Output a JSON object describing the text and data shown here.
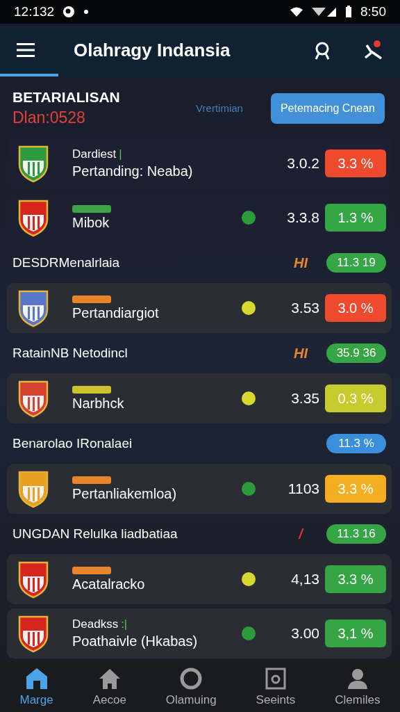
{
  "status_bar": {
    "time_left": "12:132",
    "time_right": "8:50"
  },
  "app_bar": {
    "title": "Olahragy Indansia"
  },
  "header": {
    "title": "BETARIALISAN",
    "subtitle": "Dlan:0528",
    "link": "Vrertimian",
    "button": "Petemacing Cnean"
  },
  "items": [
    {
      "kind": "match",
      "crest": {
        "color": "#2e9a3e"
      },
      "top": "Dardiest",
      "top_mark": "|",
      "name": "Pertanding: Neaba)",
      "odds": "3.0.2",
      "pct": {
        "text": "3.3 %",
        "color": "#f04a2e"
      }
    },
    {
      "kind": "match",
      "crest": {
        "color": "#d8261e"
      },
      "tag": {
        "color": "#3fa34a"
      },
      "name": "Mibok",
      "dot": {
        "color": "#2e9a3e"
      },
      "odds": "3.3.8",
      "pct": {
        "text": "1.3 %",
        "color": "#35a545"
      }
    },
    {
      "kind": "section",
      "label": "DESDRMenalrlaia",
      "marker": {
        "text": "HI",
        "color": "#e8842a"
      },
      "pill": {
        "text": "11.3 19",
        "color": "#35a545"
      }
    },
    {
      "kind": "match",
      "crest": {
        "color": "#5877c8"
      },
      "tag": {
        "color": "#e8842a"
      },
      "name": "Pertandiargiot",
      "dot": {
        "color": "#d8d831"
      },
      "odds": "3.53",
      "pct": {
        "text": "3.0 %",
        "color": "#f04a2e"
      }
    },
    {
      "kind": "section",
      "label": "RatainNB Netodincl",
      "marker": {
        "text": "HI",
        "color": "#e8842a"
      },
      "pill": {
        "text": "35.9 36",
        "color": "#35a545"
      }
    },
    {
      "kind": "match",
      "crest": {
        "color": "#d84030"
      },
      "tag": {
        "color": "#c9c22c"
      },
      "name": "Narbhck",
      "dot": {
        "color": "#d8d831"
      },
      "odds": "3.35",
      "pct": {
        "text": "0.3 %",
        "color": "#c6cc2e"
      }
    },
    {
      "kind": "section",
      "label": "Benarolao IRonalaei",
      "pill": {
        "text": "11.3 %",
        "color": "#3a8fdc"
      }
    },
    {
      "kind": "match",
      "crest": {
        "color": "#e8a020"
      },
      "tag": {
        "color": "#e8842a"
      },
      "name": "Pertanliakemloa)",
      "dot": {
        "color": "#2e9a3e"
      },
      "odds": "1103",
      "pct": {
        "text": "3.3 %",
        "color": "#f4ae22"
      }
    },
    {
      "kind": "section",
      "label": "UNGDAN Relulka liadbatiaa",
      "marker": {
        "text": "/",
        "color": "#e0302a"
      },
      "pill": {
        "text": "11.3 16",
        "color": "#35a545"
      }
    },
    {
      "kind": "match",
      "crest": {
        "color": "#d8261e"
      },
      "tag": {
        "color": "#e8842a"
      },
      "name": "Acatalracko",
      "dot": {
        "color": "#d8d831"
      },
      "odds": "4,13",
      "pct": {
        "text": "3.3 %",
        "color": "#35a545"
      }
    },
    {
      "kind": "match",
      "crest": {
        "color": "#d8261e"
      },
      "top": "Deadkss",
      "top_mark": ":|",
      "name": "Poathaivle (Hkabas)",
      "dot": {
        "color": "#2e9a3e"
      },
      "odds": "3.00",
      "pct": {
        "text": "3,1 %",
        "color": "#35a545"
      }
    }
  ],
  "nav": [
    {
      "label": "Marge",
      "selected": true
    },
    {
      "label": "Aecoe",
      "selected": false
    },
    {
      "label": "Olamuing",
      "selected": false
    },
    {
      "label": "Seeints",
      "selected": false
    },
    {
      "label": "Clemiles",
      "selected": false
    }
  ]
}
